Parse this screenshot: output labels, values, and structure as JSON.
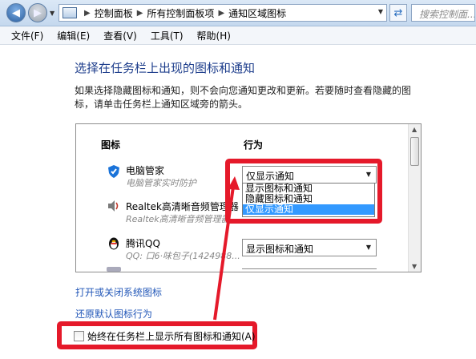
{
  "address_bar": {
    "breadcrumb": [
      "控制面板",
      "所有控制面板项",
      "通知区域图标"
    ],
    "search_placeholder": "搜索控制面..."
  },
  "menu": {
    "items": [
      "文件(F)",
      "编辑(E)",
      "查看(V)",
      "工具(T)",
      "帮助(H)"
    ]
  },
  "page": {
    "title": "选择在任务栏上出现的图标和通知",
    "description": "如果选择隐藏图标和通知，则不会向您通知更改和更新。若要随时查看隐藏的图标，请单击任务栏上通知区域旁的箭头。"
  },
  "list": {
    "header_icon": "图标",
    "header_action": "行为",
    "items": [
      {
        "name": "电脑管家",
        "subtitle": "电脑管家实时防护",
        "icon": "shield-icon",
        "behavior": "仅显示通知"
      },
      {
        "name": "Realtek高清晰音频管理器",
        "subtitle": "Realtek高清晰音频管理器",
        "icon": "speaker-icon",
        "behavior": ""
      },
      {
        "name": "腾讯QQ",
        "subtitle": "QQ: 口6·味包子(1424988...",
        "icon": "qq-penguin-icon",
        "behavior": "显示图标和通知"
      }
    ]
  },
  "dropdown": {
    "options": [
      "显示图标和通知",
      "隐藏图标和通知",
      "仅显示通知"
    ],
    "selected": "仅显示通知"
  },
  "links": {
    "toggle_system_icons": "打开或关闭系统图标",
    "restore_defaults": "还原默认图标行为"
  },
  "checkbox": {
    "label": "始终在任务栏上显示所有图标和通知(A)",
    "checked": false
  },
  "colors": {
    "annotation_red": "#e5192a",
    "selection_blue": "#3399ff",
    "title_blue": "#1e3e8c",
    "link_blue": "#2257b8"
  }
}
